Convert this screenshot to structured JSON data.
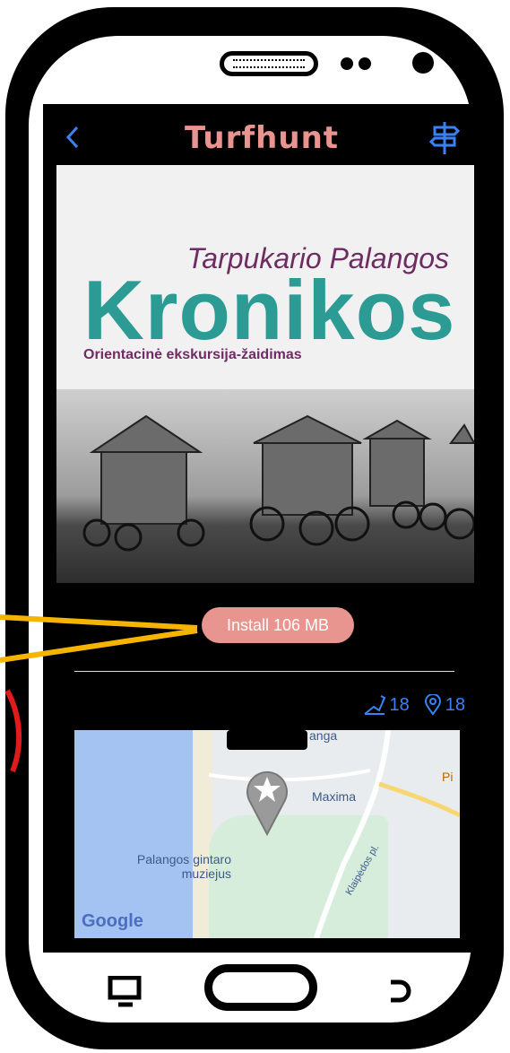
{
  "app": {
    "logo": "Turfhunt",
    "back_icon": "chevron-left-icon",
    "signpost_icon": "signpost-icon"
  },
  "hero": {
    "subtitle": "Tarpukario Palangos",
    "title": "Kronikos",
    "tagline": "Orientacinė ekskursija-žaidimas"
  },
  "install": {
    "label": "Install 106 MB"
  },
  "stats": {
    "distance_value": "18",
    "points_value": "18",
    "distance_icon": "route-distance-icon",
    "points_icon": "map-marker-icon"
  },
  "map": {
    "label_shop": "Maxima",
    "label_museum": "Palangos gintaro\nmuziejus",
    "label_street": "Klaipėdos pl.",
    "label_top": "anga",
    "label_right": "Pi",
    "google": "Google"
  },
  "colors": {
    "accent_pink": "#e8948f",
    "accent_blue": "#3b82f6",
    "teal": "#2b9b94",
    "purple": "#6e2c63",
    "annotation_orange": "#f5b400",
    "annotation_red": "#e01b1b"
  }
}
